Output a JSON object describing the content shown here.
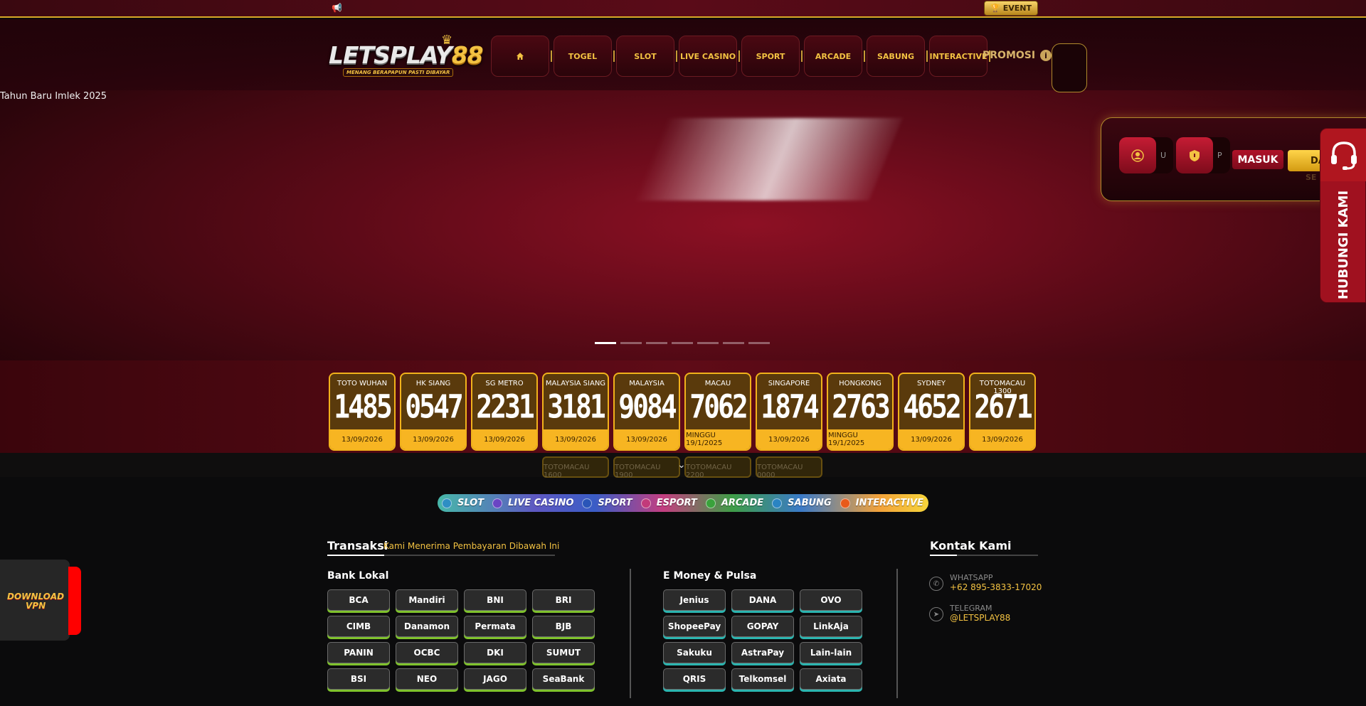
{
  "topbar": {
    "event_label": "EVENT"
  },
  "logo": {
    "word_a": "LETSPLAY",
    "word_b": "88",
    "tagline": "MENANG BERAPAPUN PASTI DIBAYAR"
  },
  "nav": {
    "items": [
      "TOGEL",
      "SLOT",
      "LIVE CASINO",
      "SPORT",
      "ARCADE",
      "SABUNG",
      "INTERACTIVE"
    ],
    "promosi": "PROMOSI",
    "promosi_info": "i"
  },
  "banner": {
    "alt_text": "Tahun Baru Imlek 2025",
    "slides": 7,
    "active_slide": 1
  },
  "login": {
    "username_placeholder": "U",
    "password_placeholder": "P",
    "login_button": "MASUK",
    "register_button": "DA",
    "forgot_link": "SE"
  },
  "hubungi": {
    "label": "HUBUNGI KAMI"
  },
  "results": [
    {
      "name": "TOTO WUHAN",
      "number": "1485",
      "date": "13/09/2026"
    },
    {
      "name": "HK SIANG",
      "number": "0547",
      "date": "13/09/2026"
    },
    {
      "name": "SG METRO",
      "number": "2231",
      "date": "13/09/2026"
    },
    {
      "name": "MALAYSIA SIANG",
      "number": "3181",
      "date": "13/09/2026"
    },
    {
      "name": "MALAYSIA",
      "number": "9084",
      "date": "13/09/2026"
    },
    {
      "name": "MACAU",
      "number": "7062",
      "date": "MINGGU 19/1/2025"
    },
    {
      "name": "SINGAPORE",
      "number": "1874",
      "date": "13/09/2026"
    },
    {
      "name": "HONGKONG",
      "number": "2763",
      "date": "MINGGU 19/1/2025"
    },
    {
      "name": "SYDNEY",
      "number": "4652",
      "date": "13/09/2026"
    },
    {
      "name": "TOTOMACAU 1300",
      "number": "2671",
      "date": "13/09/2026"
    }
  ],
  "more_results": [
    "TOTOMACAU 1600",
    "TOTOMACAU 1900",
    "TOTOMACAU 2200",
    "TOTOMACAU 0000"
  ],
  "categories": [
    {
      "label": "SLOT",
      "color": "#2e8fc4"
    },
    {
      "label": "LIVE CASINO",
      "color": "#6a45c4"
    },
    {
      "label": "SPORT",
      "color": "#2a55b8"
    },
    {
      "label": "ESPORT",
      "color": "#c23a7a"
    },
    {
      "label": "ARCADE",
      "color": "#3aa23c"
    },
    {
      "label": "SABUNG",
      "color": "#2a84c2"
    },
    {
      "label": "INTERACTIVE",
      "color": "#e85a1a"
    }
  ],
  "transaksi": {
    "title": "Transaksi",
    "subtitle": "Kami Menerima Pembayaran Dibawah Ini",
    "bank_lokal_title": "Bank Lokal",
    "bank_lokal": [
      "BCA",
      "Mandiri",
      "BNI",
      "BRI",
      "CIMB",
      "Danamon",
      "Permata",
      "BJB",
      "PANIN",
      "OCBC",
      "DKI",
      "SUMUT",
      "BSI",
      "NEO",
      "JAGO",
      "SeaBank"
    ],
    "emoney_title": "E Money & Pulsa",
    "emoney": [
      "Jenius",
      "DANA",
      "OVO",
      "ShopeePay",
      "GOPAY",
      "LinkAja",
      "Sakuku",
      "AstraPay",
      "Lain-lain",
      "QRIS",
      "Telkomsel",
      "Axiata"
    ]
  },
  "kontak": {
    "title": "Kontak Kami",
    "whatsapp_label": "WHATSAPP",
    "whatsapp_value": "+62 895-3833-17020",
    "telegram_label": "TELEGRAM",
    "telegram_value": "@LETSPLAY88"
  },
  "vpn": {
    "line1": "DOWNLOAD",
    "line2": "VPN"
  }
}
